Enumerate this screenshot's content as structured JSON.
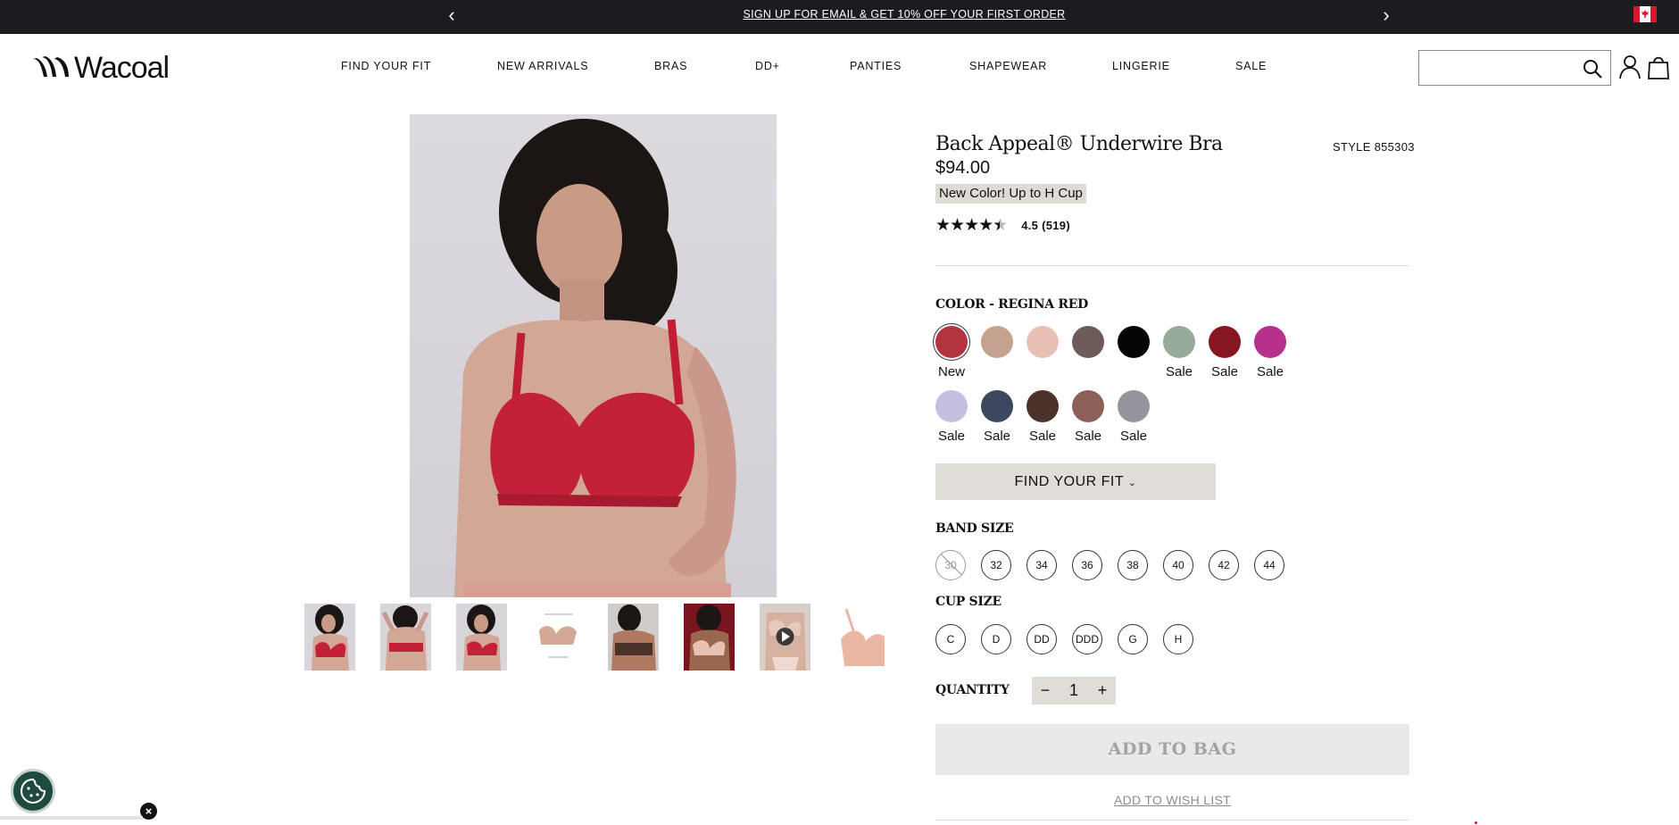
{
  "promo": {
    "text": "SIGN UP FOR EMAIL & GET 10% OFF YOUR FIRST ORDER",
    "prev_icon": "chevron-left-icon",
    "next_icon": "chevron-right-icon",
    "flag": "canada-flag-icon"
  },
  "header": {
    "logo": "Wacoal",
    "nav": [
      "FIND YOUR FIT",
      "NEW ARRIVALS",
      "BRAS",
      "DD+",
      "PANTIES",
      "SHAPEWEAR",
      "LINGERIE",
      "SALE"
    ],
    "search_placeholder": "",
    "icons": [
      "search-icon",
      "account-icon",
      "shopping-bag-icon"
    ]
  },
  "product": {
    "title": "Back Appeal® Underwire Bra",
    "style": "STYLE 855303",
    "price": "$94.00",
    "tag": "New Color! Up to H Cup",
    "rating_value": 4.5,
    "rating_text": "4.5 (519)",
    "stars": "★★★★★"
  },
  "color": {
    "label": "COLOR - REGINA RED",
    "swatches": [
      {
        "hex": "#b23440",
        "label": "New",
        "selected": true
      },
      {
        "hex": "#c4a28f",
        "label": ""
      },
      {
        "hex": "#e8c1b2",
        "label": ""
      },
      {
        "hex": "#6e5a58",
        "label": ""
      },
      {
        "hex": "#050505",
        "label": ""
      },
      {
        "hex": "#97ab9b",
        "label": "Sale"
      },
      {
        "hex": "#861621",
        "label": "Sale"
      },
      {
        "hex": "#b7318c",
        "label": "Sale"
      },
      {
        "hex": "#c7bfe0",
        "label": "Sale"
      },
      {
        "hex": "#3d475d",
        "label": "Sale"
      },
      {
        "hex": "#4a3129",
        "label": "Sale"
      },
      {
        "hex": "#8a6058",
        "label": "Sale"
      },
      {
        "hex": "#94949c",
        "label": "Sale"
      }
    ]
  },
  "fit_button": "FIND YOUR FIT",
  "band_size": {
    "label": "BAND SIZE",
    "options": [
      "30",
      "32",
      "34",
      "36",
      "38",
      "40",
      "42",
      "44"
    ],
    "unavailable": [
      "30"
    ]
  },
  "cup_size": {
    "label": "CUP SIZE",
    "options": [
      "C",
      "D",
      "DD",
      "DDD",
      "G",
      "H"
    ]
  },
  "quantity": {
    "label": "QUANTITY",
    "value": "1",
    "minus": "−",
    "plus": "+"
  },
  "actions": {
    "add_to_bag": "ADD TO BAG",
    "wishlist": "ADD TO WISH LIST"
  },
  "gallery": {
    "thumbnail_count": 8,
    "video_thumbnail_index": 6
  },
  "cookie": {
    "icon": "cookie-settings-icon",
    "close": "×"
  }
}
